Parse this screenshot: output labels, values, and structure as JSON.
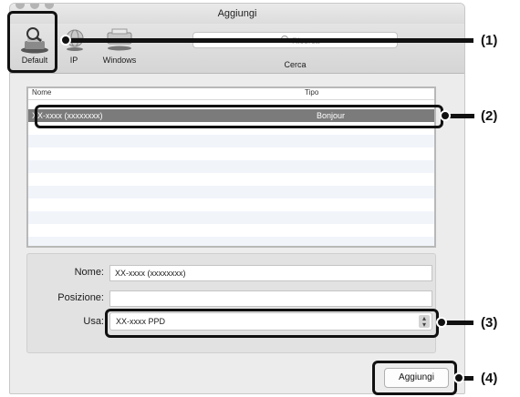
{
  "window": {
    "title": "Aggiungi"
  },
  "toolbar": {
    "default_label": "Default",
    "ip_label": "IP",
    "windows_label": "Windows",
    "search_label": "Cerca",
    "search_placeholder": "Ricerca"
  },
  "list": {
    "col_name": "Nome",
    "col_type": "Tipo",
    "selected_name": "XX-xxxx (xxxxxxxx)",
    "selected_type": "Bonjour"
  },
  "form": {
    "name_label": "Nome:",
    "name_value": "XX-xxxx (xxxxxxxx)",
    "location_label": "Posizione:",
    "location_value": "",
    "use_label": "Usa:",
    "use_value": "XX-xxxx PPD"
  },
  "actions": {
    "add_label": "Aggiungi"
  },
  "callouts": [
    "(1)",
    "(2)",
    "(3)",
    "(4)"
  ]
}
